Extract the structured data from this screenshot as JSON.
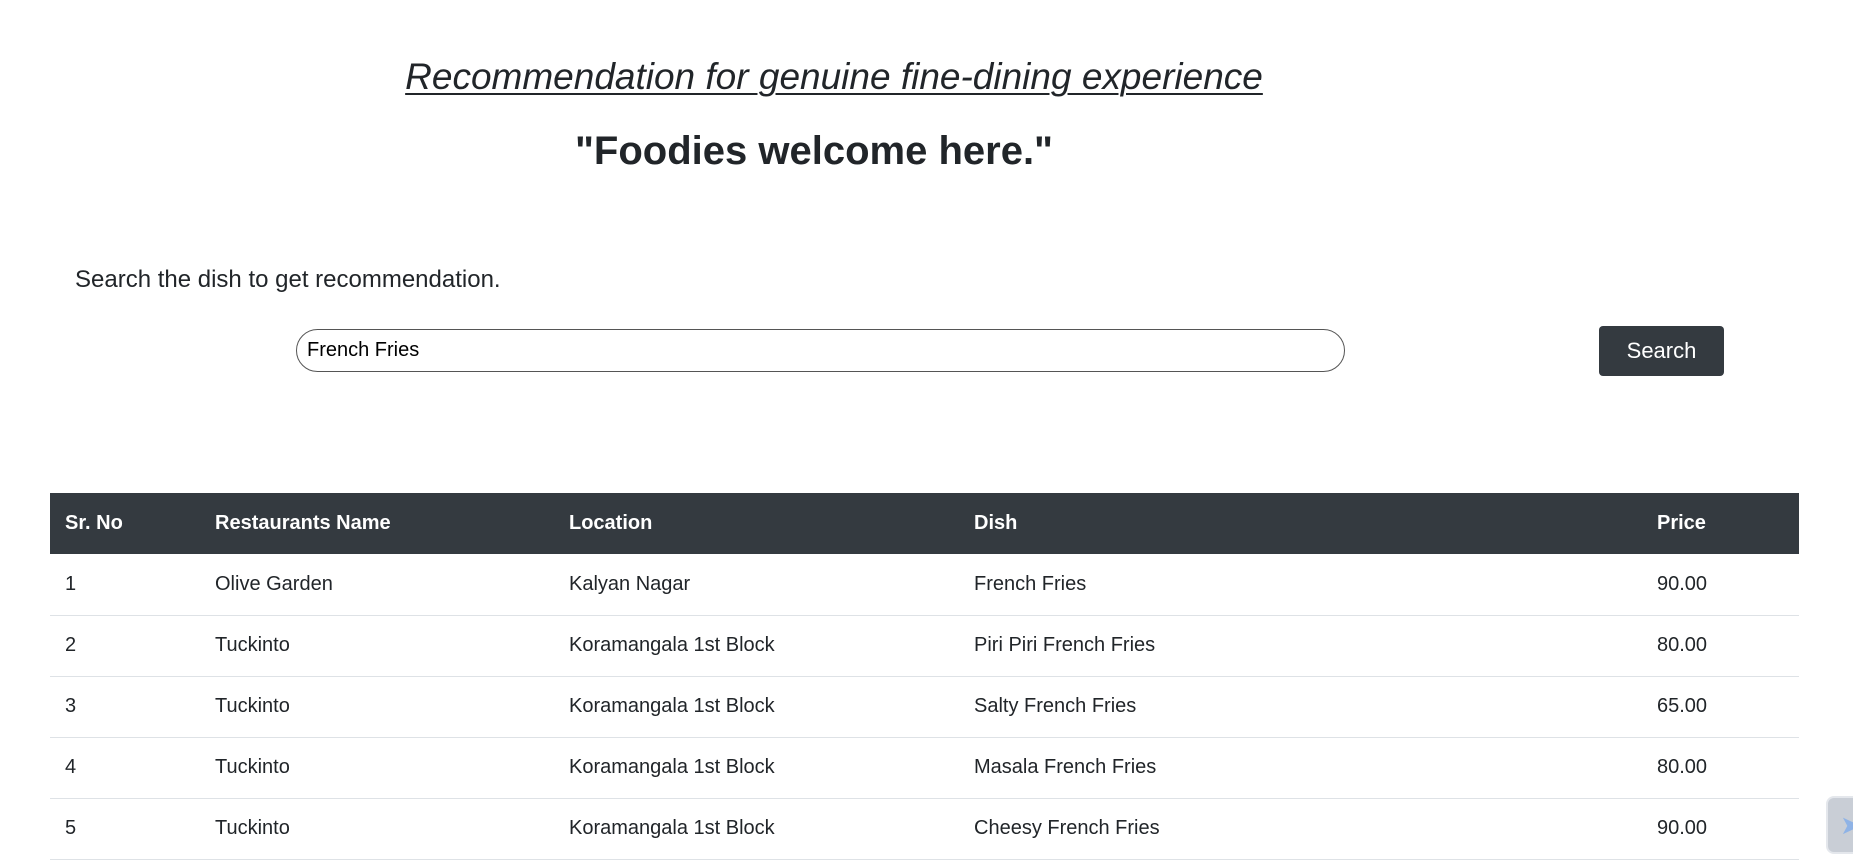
{
  "header": {
    "tagline": "Recommendation for genuine fine-dining experience",
    "motto": "\"Foodies welcome here.\""
  },
  "search": {
    "hint": "Search the dish to get recommendation.",
    "value": "French Fries",
    "button_label": "Search"
  },
  "table": {
    "columns": [
      "Sr. No",
      "Restaurants Name",
      "Location",
      "Dish",
      "Price"
    ],
    "rows": [
      [
        "1",
        "Olive Garden",
        "Kalyan Nagar",
        "French Fries",
        "90.00"
      ],
      [
        "2",
        "Tuckinto",
        "Koramangala 1st Block",
        "Piri Piri French Fries",
        "80.00"
      ],
      [
        "3",
        "Tuckinto",
        "Koramangala 1st Block",
        "Salty French Fries",
        "65.00"
      ],
      [
        "4",
        "Tuckinto",
        "Koramangala 1st Block",
        "Masala French Fries",
        "80.00"
      ],
      [
        "5",
        "Tuckinto",
        "Koramangala 1st Block",
        "Cheesy French Fries",
        "90.00"
      ]
    ]
  },
  "widget": {
    "icon": "chat-bubble-icon"
  },
  "colors": {
    "header_bg": "#343a40",
    "button_bg": "#343a40",
    "text": "#212529",
    "row_border": "#dee2e6"
  }
}
